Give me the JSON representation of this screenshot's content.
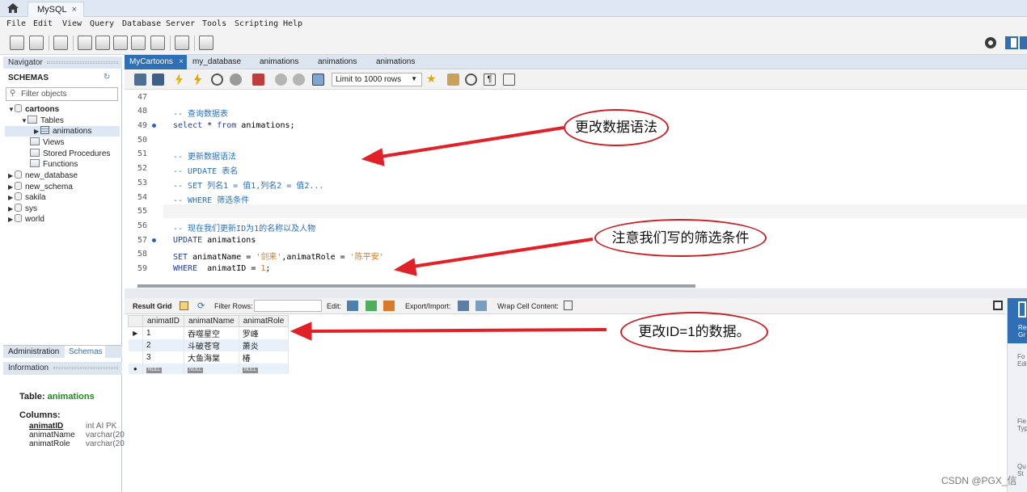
{
  "app_tab": {
    "title": "MySQL",
    "close": "×"
  },
  "menu": [
    "File",
    "Edit",
    "View",
    "Query",
    "Database",
    "Server",
    "Tools",
    "Scripting",
    "Help"
  ],
  "navigator": {
    "title": "Navigator",
    "schemas_label": "SCHEMAS",
    "filter_placeholder": "Filter objects",
    "tree": {
      "cartoons": "cartoons",
      "tables": "Tables",
      "animations": "animations",
      "views": "Views",
      "procedures": "Stored Procedures",
      "functions": "Functions",
      "others": [
        "new_database",
        "new_schema",
        "sakila",
        "sys",
        "world"
      ]
    },
    "tabs": {
      "administration": "Administration",
      "schemas": "Schemas"
    }
  },
  "information": {
    "title": "Information",
    "table_label": "Table:",
    "table_name": "animations",
    "columns_label": "Columns:",
    "columns": [
      {
        "name": "animatID",
        "type": "int AI PK"
      },
      {
        "name": "animatName",
        "type": "varchar(20"
      },
      {
        "name": "animatRole",
        "type": "varchar(20"
      }
    ]
  },
  "editor_tabs": [
    "MyCartoons",
    "my_database",
    "animations",
    "animations",
    "animations"
  ],
  "sql_toolbar": {
    "limit": "Limit to 1000 rows"
  },
  "editor": {
    "lines": [
      {
        "n": "47",
        "text": ""
      },
      {
        "n": "48",
        "text": "-- 查询数据表"
      },
      {
        "n": "49",
        "text": "select * from animations;"
      },
      {
        "n": "50",
        "text": ""
      },
      {
        "n": "51",
        "text": "-- 更新数据语法"
      },
      {
        "n": "52",
        "text": "-- UPDATE 表名"
      },
      {
        "n": "53",
        "text": "-- SET 列名1 = 值1,列名2 = 值2..."
      },
      {
        "n": "54",
        "text": "-- WHERE 筛选条件"
      },
      {
        "n": "55",
        "text": ""
      },
      {
        "n": "56",
        "text": "-- 现在我们更新ID为1的名称以及人物"
      },
      {
        "n": "57",
        "text": "UPDATE animations"
      },
      {
        "n": "58",
        "text": "SET animatName = '剑来',animatRole = '陈平安'"
      },
      {
        "n": "59",
        "text": "WHERE  animatID = 1;"
      }
    ],
    "tokens": {
      "select": "select",
      "star": " * ",
      "from": "from",
      "tbl": " animations;",
      "update": "UPDATE",
      "update_tbl": " animations",
      "set": "SET",
      "set_a": " animatName = ",
      "v1": "'剑来'",
      "set_b": ",animatRole = ",
      "v2": "'陈平安'",
      "where": "WHERE",
      "where_a": "  animatID = ",
      "id": "1",
      "semi": ";"
    }
  },
  "result_toolbar": {
    "result_grid": "Result Grid",
    "filter_rows": "Filter Rows:",
    "edit": "Edit:",
    "export": "Export/Import:",
    "wrap": "Wrap Cell Content:"
  },
  "grid": {
    "columns": [
      "animatID",
      "animatName",
      "animatRole"
    ],
    "rows": [
      [
        "1",
        "吞噬星空",
        "罗峰"
      ],
      [
        "2",
        "斗破苍穹",
        "萧炎"
      ],
      [
        "3",
        "大鱼海棠",
        "椿"
      ]
    ],
    "null_label": "NULL"
  },
  "right_bar": {
    "items": [
      "Res Gr",
      "Fo Edi",
      "Fie Typ",
      "Qu St"
    ]
  },
  "annotations": {
    "a1": "更改数据语法",
    "a2": "注意我们写的筛选条件",
    "a3": "更改ID=1的数据。"
  },
  "watermark": "CSDN @PGX_信",
  "colors": {
    "accent": "#2f6fb5",
    "annotation_red": "#cc1e25",
    "comment": "#2a6fb9",
    "string": "#d9770b"
  }
}
